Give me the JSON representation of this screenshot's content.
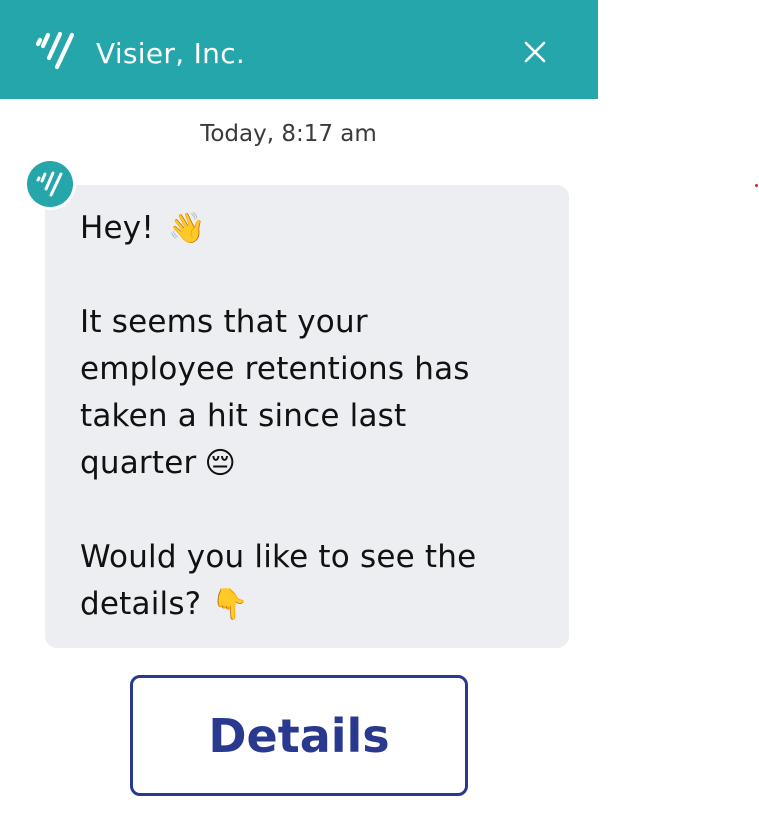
{
  "header": {
    "title": "Visier, Inc.",
    "logo_icon": "visier-logo-icon",
    "close_icon": "close-icon",
    "background_color": "#24a6aa"
  },
  "conversation": {
    "timestamp": "Today, 8:17 am",
    "avatar_icon": "visier-avatar-icon",
    "message": {
      "greeting": "Hey!",
      "greeting_emoji": "👋",
      "line1": "It seems that your",
      "line2": "employee retentions has",
      "line3": "taken a hit since last",
      "line4": "quarter",
      "line4_emoji": "😔",
      "line5": "Would you like to see the",
      "line6": "details?",
      "line6_emoji": "👇"
    },
    "bubble_color": "#eceef2"
  },
  "actions": {
    "details_label": "Details",
    "accent_color": "#2a3990"
  }
}
